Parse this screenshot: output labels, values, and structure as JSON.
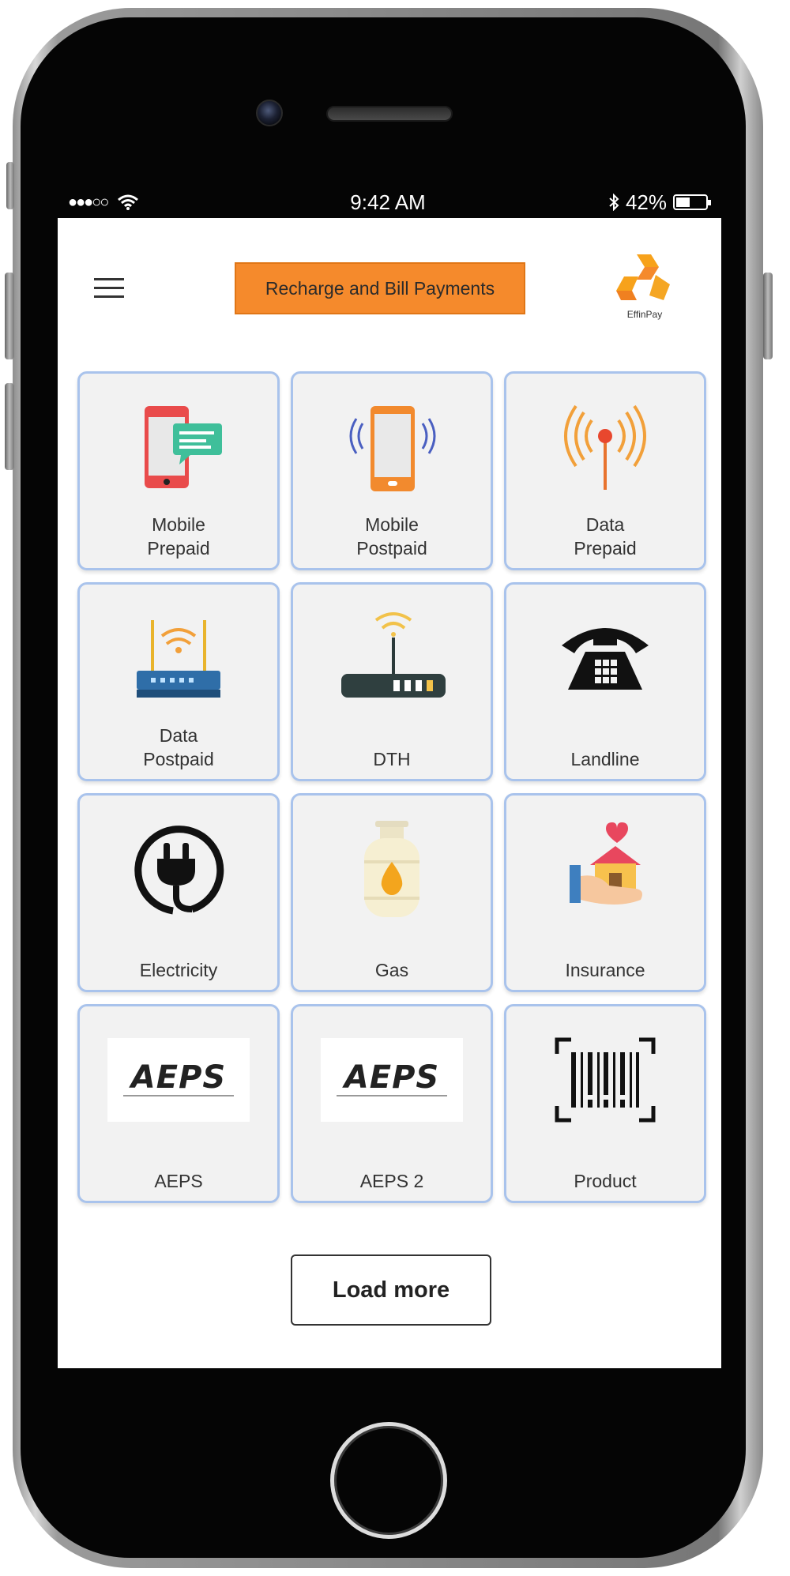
{
  "status_bar": {
    "signal": "●●●○○",
    "time": "9:42 AM",
    "battery_text": "42%",
    "battery_level": 0.42
  },
  "header": {
    "title": "Recharge and Bill Payments",
    "logo_text": "EffinPay"
  },
  "services": [
    {
      "label": "Mobile\nPrepaid",
      "icon": "mobile-chat-icon"
    },
    {
      "label": "Mobile\nPostpaid",
      "icon": "mobile-vibrate-icon"
    },
    {
      "label": "Data\nPrepaid",
      "icon": "antenna-signal-icon"
    },
    {
      "label": "Data\nPostpaid",
      "icon": "wifi-router-icon"
    },
    {
      "label": "DTH",
      "icon": "dth-box-icon"
    },
    {
      "label": "Landline",
      "icon": "telephone-icon"
    },
    {
      "label": "Electricity",
      "icon": "plug-icon"
    },
    {
      "label": "Gas",
      "icon": "gas-cylinder-icon"
    },
    {
      "label": "Insurance",
      "icon": "house-insurance-icon"
    },
    {
      "label": "AEPS",
      "icon": "aeps-logo"
    },
    {
      "label": "AEPS 2",
      "icon": "aeps-logo"
    },
    {
      "label": "Product",
      "icon": "barcode-icon"
    }
  ],
  "aeps_logo_text": "AEPS",
  "load_more_label": "Load more",
  "colors": {
    "accent": "#f58a2c",
    "tile_border": "#a9c3ec",
    "tile_bg": "#f2f2f2"
  }
}
